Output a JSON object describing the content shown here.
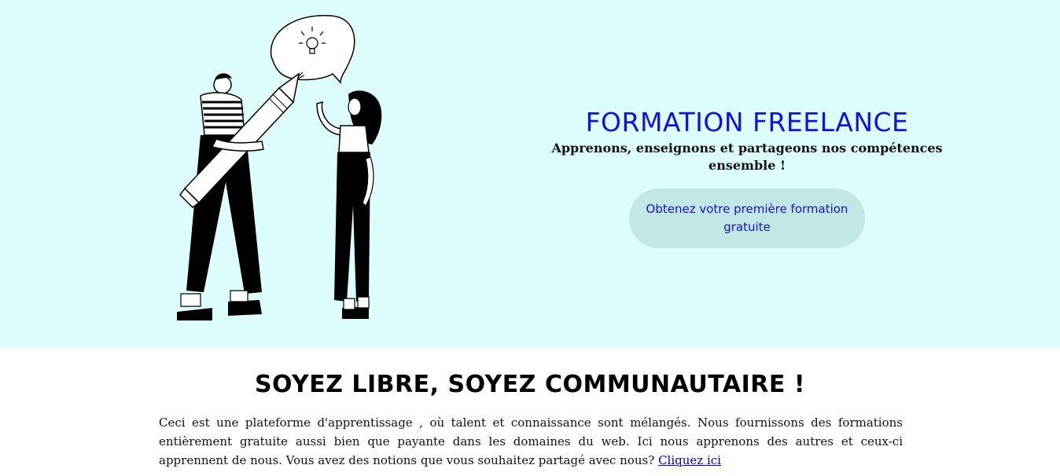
{
  "hero": {
    "title": "FORMATION FREELANCE",
    "subtitle": "Apprenons, enseignons et partageons nos compétences ensemble !",
    "cta_label": "Obtenez votre première formation gratuite",
    "illustration": "two-people-idea-illustration"
  },
  "section": {
    "title": "SOYEZ LIBRE, SOYEZ COMMUNAUTAIRE !",
    "body": "Ceci est une plateforme d'apprentissage , où talent et connaissance sont mélangés. Nous fournissons des formations entièrement gratuite aussi bien que payante dans les domaines du web. Ici nous apprenons des autres et ceux-ci apprennent de nous. Vous avez des notions que vous souhaitez partagé avec nous?",
    "link_label": "Cliquez ici"
  },
  "colors": {
    "hero_bg": "#ddfcfc",
    "title_blue": "#1010e0",
    "cta_bg": "#c2e8e6",
    "link": "#0000cc"
  }
}
